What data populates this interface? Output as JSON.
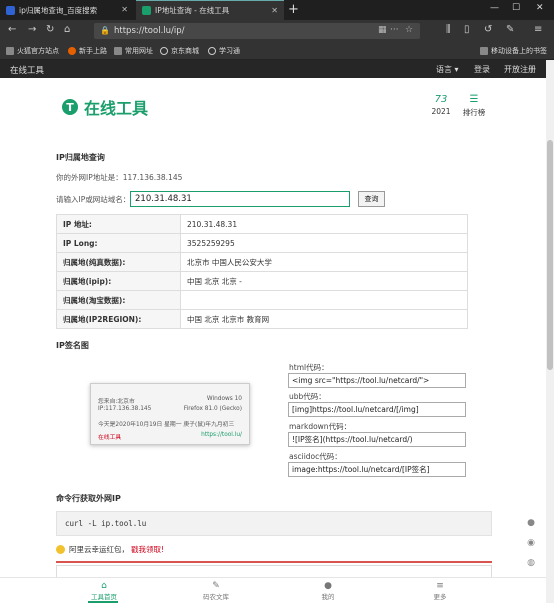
{
  "browser": {
    "tabs": [
      {
        "title": "ip归属地查询_百度搜索"
      },
      {
        "title": "IP地址查询 - 在线工具"
      }
    ],
    "url": "https://tool.lu/ip/",
    "bookmarks": [
      "火狐官方站点",
      "新手上路",
      "常用网址",
      "京东商城",
      "学习通"
    ],
    "bookmarks_right": "移动设备上的书签"
  },
  "site": {
    "brand": "在线工具",
    "nav": {
      "language": "语言 ▾",
      "login": "登录",
      "register": "开放注册"
    },
    "logo_text": "在线工具",
    "logo_letter": "T",
    "stat_value": "73",
    "stat_year": "2021",
    "rank_label": "排行榜"
  },
  "ip_lookup": {
    "title": "IP归属地查询",
    "your_ip_label": "你的外网IP地址是：117.136.38.145",
    "input_label": "请输入IP或网站域名：",
    "input_value": "210.31.48.31",
    "query_button": "查询",
    "rows": [
      {
        "key": "IP 地址:",
        "value": "210.31.48.31"
      },
      {
        "key": "IP Long:",
        "value": "3525259295"
      },
      {
        "key": "归属地(纯真数据):",
        "value": "北京市 中国人民公安大学"
      },
      {
        "key": "归属地(ipip):",
        "value": "中国 北京 北京 -"
      },
      {
        "key": "归属地(淘宝数据):",
        "value": ""
      },
      {
        "key": "归属地(IP2REGION):",
        "value": "中国 北京 北京市 教育网"
      }
    ]
  },
  "signature": {
    "title": "IP签名图",
    "card": {
      "from": "您来自:北京市",
      "os": "Windows 10",
      "ip": "IP:117.136.38.145",
      "browser": "Firefox 81.0 (Gecko)",
      "date": "今天是2020年10月19日 星期一 庚子(鼠)年九月初三",
      "brand": "在线工具",
      "url": "https://tool.lu/"
    },
    "codes": [
      {
        "label": "html代码：",
        "value": "<img src=\"https://tool.lu/netcard/\">"
      },
      {
        "label": "ubb代码：",
        "value": "[img]https://tool.lu/netcard/[/img]"
      },
      {
        "label": "markdown代码：",
        "value": "![IP签名](https://tool.lu/netcard/)"
      },
      {
        "label": "asciidoc代码：",
        "value": "image:https://tool.lu/netcard/[IP签名]"
      }
    ]
  },
  "cmdline": {
    "title": "命令行获取外网IP",
    "command": "curl -L ip.tool.lu"
  },
  "promo": {
    "text": "阿里云幸运红包，",
    "link": "戳我领取!"
  },
  "bottom_nav": [
    {
      "label": "工具首页",
      "icon": "home-icon"
    },
    {
      "label": "码农文库",
      "icon": "pen-icon"
    },
    {
      "label": "我的",
      "icon": "user-icon"
    },
    {
      "label": "更多",
      "icon": "menu-icon"
    }
  ]
}
